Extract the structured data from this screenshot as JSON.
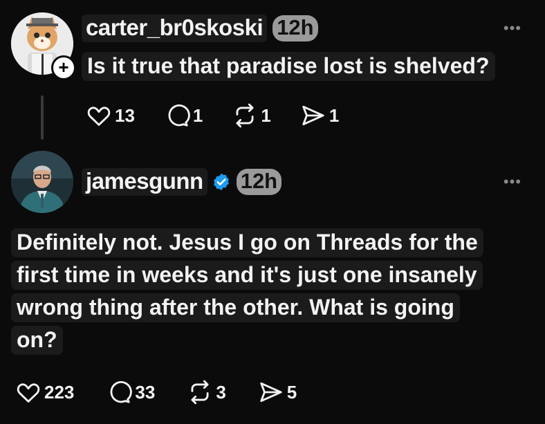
{
  "posts": [
    {
      "username": "carter_br0skoski",
      "time": "12h",
      "text": "Is it true that paradise lost is shelved?",
      "more": "•••",
      "add_badge": "+",
      "avatar_icon": "cat-avatar",
      "likes": "13",
      "comments": "1",
      "reposts": "1",
      "shares": "1"
    },
    {
      "username": "jamesgunn",
      "verified": true,
      "time": "12h",
      "more": "•••",
      "avatar_icon": "person-avatar",
      "text_lines": [
        "Definitely not. Jesus I go on Threads for the",
        "first time in weeks and it's just one insanely",
        "wrong thing after the other. What is going",
        "on?"
      ],
      "likes": "223",
      "comments": "33",
      "reposts": "3",
      "shares": "5"
    }
  ],
  "colors": {
    "background": "#0b0b0b",
    "verified": "#1d9bf0",
    "text": "#f3f3f3",
    "muted": "#8a8a8a"
  }
}
